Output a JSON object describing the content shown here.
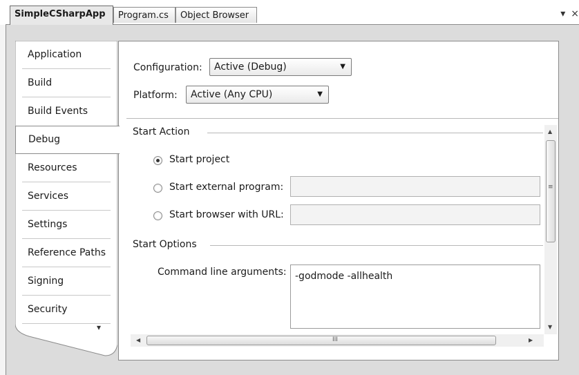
{
  "tabs": [
    {
      "label": "SimpleCSharpApp",
      "active": true
    },
    {
      "label": "Program.cs",
      "active": false
    },
    {
      "label": "Object Browser",
      "active": false
    }
  ],
  "window_controls": {
    "dropdown_icon": "chevron-down-icon",
    "close_icon": "close-icon"
  },
  "sidebar": {
    "items": [
      {
        "label": "Application"
      },
      {
        "label": "Build"
      },
      {
        "label": "Build Events"
      },
      {
        "label": "Debug",
        "active": true
      },
      {
        "label": "Resources"
      },
      {
        "label": "Services"
      },
      {
        "label": "Settings"
      },
      {
        "label": "Reference Paths"
      },
      {
        "label": "Signing"
      },
      {
        "label": "Security"
      }
    ],
    "overflow_icon": "overflow-chevron-icon"
  },
  "config": {
    "configuration_label": "Configuration:",
    "configuration_value": "Active (Debug)",
    "platform_label": "Platform:",
    "platform_value": "Active (Any CPU)"
  },
  "start_action": {
    "title": "Start Action",
    "options": [
      {
        "label": "Start project",
        "selected": true
      },
      {
        "label": "Start external program:",
        "selected": false,
        "value": ""
      },
      {
        "label": "Start browser with URL:",
        "selected": false,
        "value": ""
      }
    ]
  },
  "start_options": {
    "title": "Start Options",
    "cmd_args_label": "Command line arguments:",
    "cmd_args_value": "-godmode -allhealth"
  },
  "scrollbar": {
    "grip_vertical": "≡",
    "grip_horizontal": "III"
  }
}
